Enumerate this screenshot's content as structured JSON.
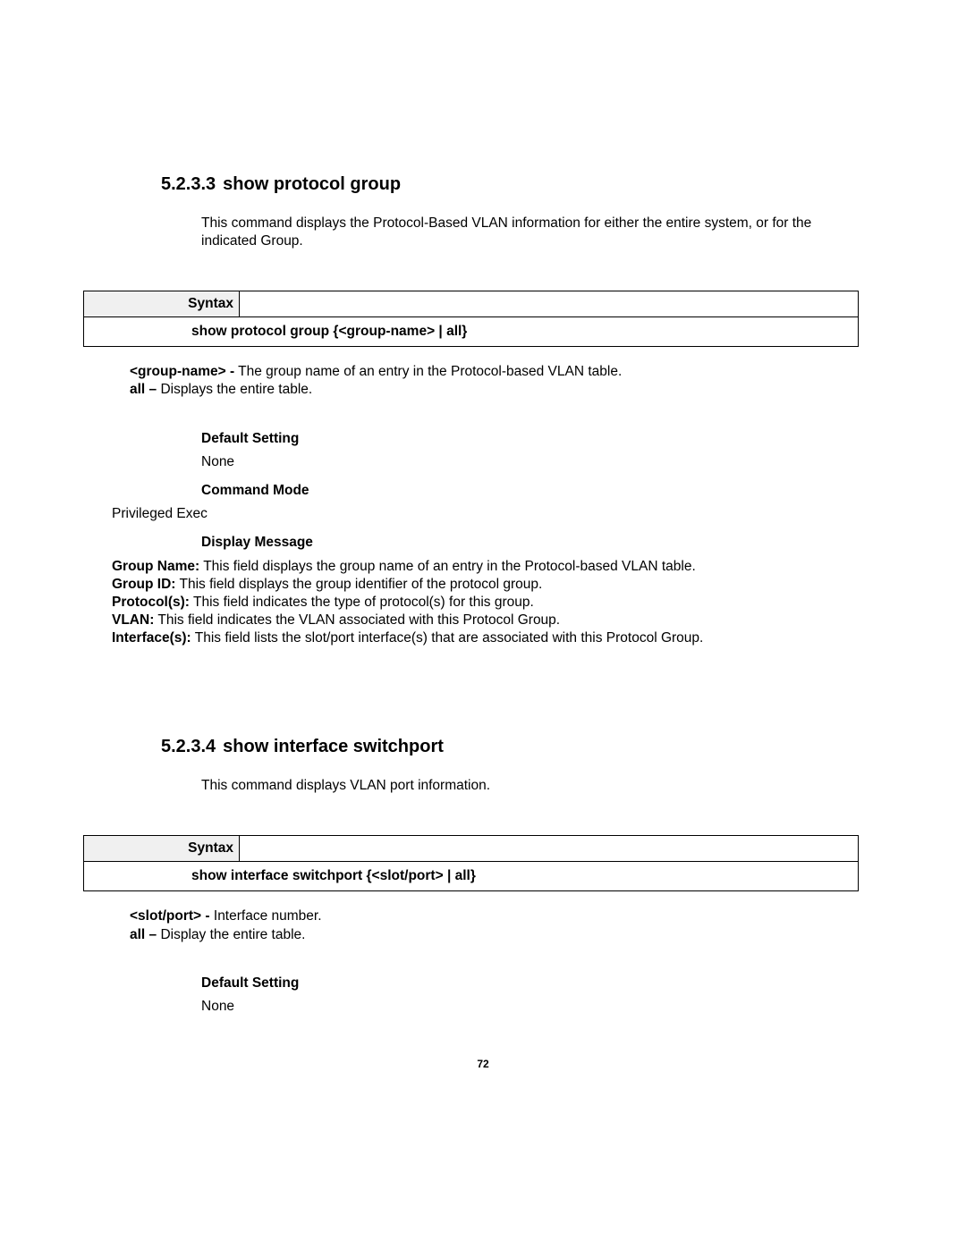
{
  "page_number": "72",
  "sections": [
    {
      "number": "5.2.3.3",
      "title": "show protocol group",
      "intro": "This command displays the Protocol-Based VLAN information for either the entire system, or for the indicated Group.",
      "syntax_label": "Syntax",
      "syntax_body": "show protocol group {<group-name> | all}",
      "params": [
        {
          "key": "<group-name> -",
          "desc": " The group name of an entry in the Protocol-based VLAN table."
        },
        {
          "key": "all –",
          "desc": " Displays the entire table."
        }
      ],
      "subs": [
        {
          "heading": "Default Setting",
          "value": "None",
          "value_left": false
        },
        {
          "heading": "Command Mode",
          "value": "Privileged Exec",
          "value_left": true
        },
        {
          "heading": "Display Message",
          "value": null,
          "value_left": false
        }
      ],
      "display_lines": [
        {
          "key": "Group Name:",
          "desc": " This field displays the group name of an entry in the Protocol-based VLAN table."
        },
        {
          "key": "Group ID:",
          "desc": " This field displays the group identifier of the protocol group."
        },
        {
          "key": "Protocol(s):",
          "desc": " This field indicates the type of protocol(s) for this group."
        },
        {
          "key": "VLAN:",
          "desc": " This field indicates the VLAN associated with this Protocol Group."
        },
        {
          "key": "Interface(s):",
          "desc": " This field lists the slot/port interface(s) that are associated with this Protocol Group."
        }
      ]
    },
    {
      "number": "5.2.3.4",
      "title": "show interface switchport",
      "intro": "This command displays VLAN port information.",
      "syntax_label": "Syntax",
      "syntax_body": "show interface switchport {<slot/port> | all}",
      "params": [
        {
          "key": "<slot/port> -",
          "desc": " Interface number."
        },
        {
          "key": "all –",
          "desc": " Display the entire table."
        }
      ],
      "subs": [
        {
          "heading": "Default Setting",
          "value": "None",
          "value_left": false
        }
      ],
      "display_lines": []
    }
  ]
}
